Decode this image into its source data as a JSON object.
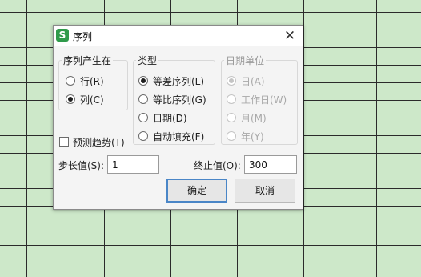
{
  "dialog": {
    "title": "序列",
    "app_icon_letter": "S",
    "close_glyph": "✕"
  },
  "origin": {
    "legend": "序列产生在",
    "options": [
      {
        "text": "行(R)",
        "selected": false
      },
      {
        "text": "列(C)",
        "selected": true
      }
    ]
  },
  "type": {
    "legend": "类型",
    "options": [
      {
        "text": "等差序列(L)",
        "selected": true
      },
      {
        "text": "等比序列(G)",
        "selected": false
      },
      {
        "text": "日期(D)",
        "selected": false
      },
      {
        "text": "自动填充(F)",
        "selected": false
      }
    ]
  },
  "date_unit": {
    "legend": "日期单位",
    "enabled": false,
    "options": [
      {
        "text": "日(A)",
        "selected": true
      },
      {
        "text": "工作日(W)",
        "selected": false
      },
      {
        "text": "月(M)",
        "selected": false
      },
      {
        "text": "年(Y)",
        "selected": false
      }
    ]
  },
  "trend": {
    "text": "预测趋势(T)",
    "checked": false
  },
  "step": {
    "label": "步长值(S):",
    "value": "1"
  },
  "stop": {
    "label": "终止值(O):",
    "value": "300"
  },
  "buttons": {
    "ok": "确定",
    "cancel": "取消"
  },
  "colors": {
    "sheet_bg": "#cde8c9",
    "default_button_border": "#4a86c7"
  }
}
